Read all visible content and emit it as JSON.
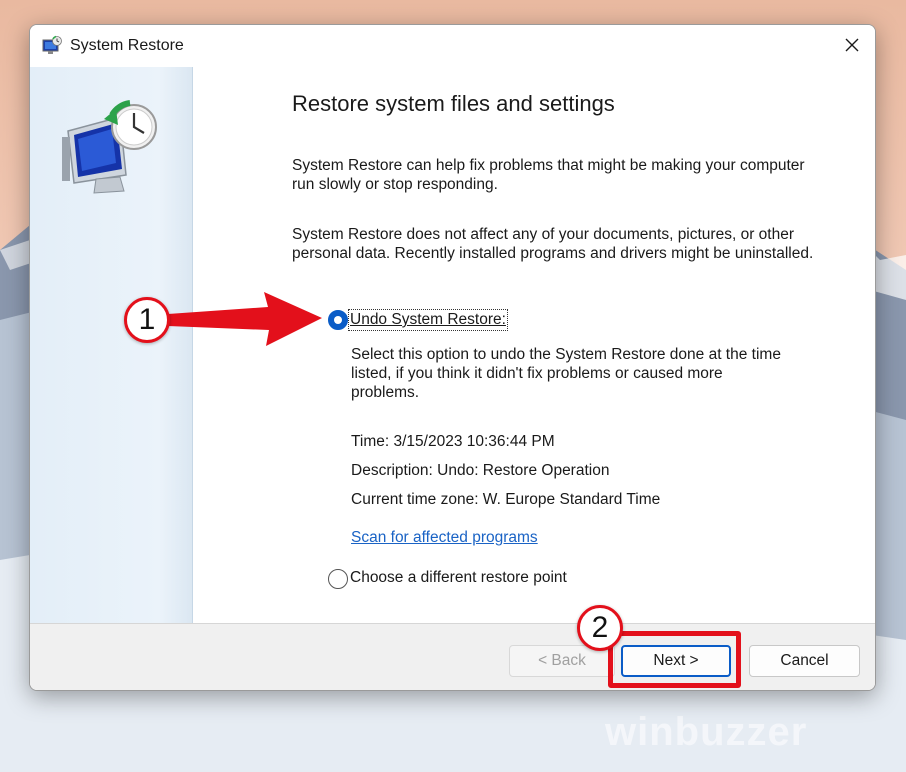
{
  "window": {
    "title": "System Restore",
    "close_icon": "close-icon",
    "app_icon": "system-restore-icon"
  },
  "side": {
    "hero_icon": "monitor-clock-restore-icon"
  },
  "main": {
    "heading": "Restore system files and settings",
    "para1": "System Restore can help fix problems that might be making your computer run slowly or stop responding.",
    "para2": "System Restore does not affect any of your documents, pictures, or other personal data. Recently installed programs and drivers might be uninstalled.",
    "options": [
      {
        "label": "Undo System Restore:",
        "selected": true
      },
      {
        "label": "Choose a different restore point",
        "selected": false
      }
    ],
    "undo_description": "Select this option to undo the System Restore done at the time listed, if you think it didn't fix problems or caused more problems.",
    "details": {
      "time": "Time: 3/15/2023 10:36:44 PM",
      "description": "Description: Undo: Restore Operation",
      "timezone": "Current time zone: W. Europe Standard Time"
    },
    "scan_link": "Scan for affected programs"
  },
  "footer": {
    "back_label": "< Back",
    "next_label": "Next >",
    "cancel_label": "Cancel"
  },
  "annotations": {
    "step1": "1",
    "step2": "2",
    "accent_color": "#e3101b"
  },
  "watermark": "winbuzzer"
}
